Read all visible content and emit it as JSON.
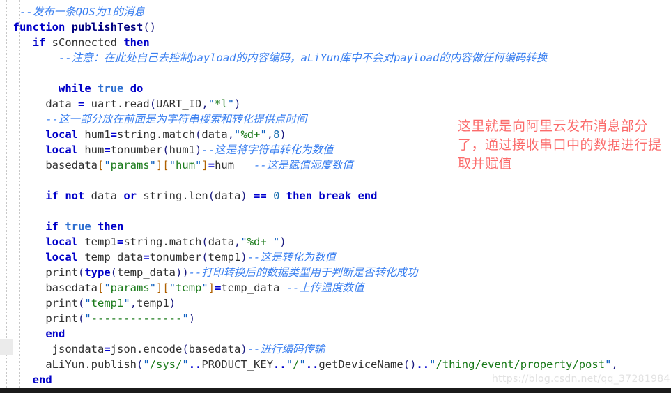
{
  "editor": {
    "language": "lua",
    "background_color": "#ffffff",
    "indent_guide_color": "#c8c8c8",
    "comment_color": "#3a7ff0",
    "keyword_color": "#0000c8",
    "string_color": "#1a7a1a",
    "annotation_color": "#fb6b6b",
    "watermark_color": "#e2e2e2",
    "bottom_bar_color": "#1b1b1b"
  },
  "code": {
    "lines": [
      {
        "id": "line-1",
        "segments": [
          {
            "t": "--发布一条QOS为1的消息",
            "c": "cmt"
          }
        ],
        "indent": 2
      },
      {
        "id": "line-2",
        "segments": [
          {
            "t": "function",
            "c": "kw"
          },
          {
            "t": " ",
            "c": "id"
          },
          {
            "t": "publishTest",
            "c": "fn"
          },
          {
            "t": "()",
            "c": "punc"
          }
        ],
        "indent": 1
      },
      {
        "id": "line-3",
        "segments": [
          {
            "t": "if",
            "c": "kw"
          },
          {
            "t": " sConnected ",
            "c": "id"
          },
          {
            "t": "then",
            "c": "kw"
          }
        ],
        "indent": 4
      },
      {
        "id": "line-4",
        "segments": [
          {
            "t": "--注意：在此处自己去控制payload的内容编码，aLiYun库中不会对payload的内容做任何编码转换",
            "c": "cmt"
          }
        ],
        "indent": 8
      },
      {
        "id": "line-5",
        "segments": [],
        "indent": 0
      },
      {
        "id": "line-6",
        "segments": [
          {
            "t": "while",
            "c": "kw"
          },
          {
            "t": " ",
            "c": "id"
          },
          {
            "t": "true",
            "c": "bool"
          },
          {
            "t": " ",
            "c": "id"
          },
          {
            "t": "do",
            "c": "kw"
          }
        ],
        "indent": 8
      },
      {
        "id": "line-7",
        "segments": [
          {
            "t": "data ",
            "c": "id"
          },
          {
            "t": "=",
            "c": "op"
          },
          {
            "t": " uart",
            "c": "id"
          },
          {
            "t": ".",
            "c": "dot"
          },
          {
            "t": "read",
            "c": "id"
          },
          {
            "t": "(",
            "c": "punc"
          },
          {
            "t": "UART_ID",
            "c": "id"
          },
          {
            "t": ",",
            "c": "punc"
          },
          {
            "t": "\"",
            "c": "quo"
          },
          {
            "t": "*l",
            "c": "str"
          },
          {
            "t": "\"",
            "c": "quo"
          },
          {
            "t": ")",
            "c": "punc"
          }
        ],
        "indent": 6
      },
      {
        "id": "line-8",
        "segments": [
          {
            "t": "--这一部分放在前面是为字符串搜索和转化提供点时间",
            "c": "cmt"
          }
        ],
        "indent": 6
      },
      {
        "id": "line-9",
        "segments": [
          {
            "t": "local",
            "c": "kw"
          },
          {
            "t": " hum1",
            "c": "id"
          },
          {
            "t": "=",
            "c": "op"
          },
          {
            "t": "string",
            "c": "id"
          },
          {
            "t": ".",
            "c": "dot"
          },
          {
            "t": "match",
            "c": "id"
          },
          {
            "t": "(",
            "c": "punc"
          },
          {
            "t": "data",
            "c": "id"
          },
          {
            "t": ",",
            "c": "punc"
          },
          {
            "t": "\"",
            "c": "quo"
          },
          {
            "t": "%d+",
            "c": "str"
          },
          {
            "t": "\"",
            "c": "quo"
          },
          {
            "t": ",",
            "c": "punc"
          },
          {
            "t": "8",
            "c": "num"
          },
          {
            "t": ")",
            "c": "punc"
          }
        ],
        "indent": 6
      },
      {
        "id": "line-10",
        "segments": [
          {
            "t": "local",
            "c": "kw"
          },
          {
            "t": " hum",
            "c": "id"
          },
          {
            "t": "=",
            "c": "op"
          },
          {
            "t": "tonumber",
            "c": "id"
          },
          {
            "t": "(",
            "c": "punc"
          },
          {
            "t": "hum1",
            "c": "id"
          },
          {
            "t": ")",
            "c": "punc"
          },
          {
            "t": "--这是将字符串转化为数值",
            "c": "cmt"
          }
        ],
        "indent": 6
      },
      {
        "id": "line-11",
        "segments": [
          {
            "t": "basedata",
            "c": "id"
          },
          {
            "t": "[",
            "c": "brk"
          },
          {
            "t": "\"",
            "c": "quo"
          },
          {
            "t": "params",
            "c": "str"
          },
          {
            "t": "\"",
            "c": "quo"
          },
          {
            "t": "]",
            "c": "brk"
          },
          {
            "t": "[",
            "c": "brk"
          },
          {
            "t": "\"",
            "c": "quo"
          },
          {
            "t": "hum",
            "c": "str"
          },
          {
            "t": "\"",
            "c": "quo"
          },
          {
            "t": "]",
            "c": "brk"
          },
          {
            "t": "=",
            "c": "op"
          },
          {
            "t": "hum",
            "c": "id"
          },
          {
            "t": "   ",
            "c": "id"
          },
          {
            "t": "--这是赋值湿度数值",
            "c": "cmt"
          }
        ],
        "indent": 6
      },
      {
        "id": "line-12",
        "segments": [],
        "indent": 0
      },
      {
        "id": "line-13",
        "segments": [
          {
            "t": "if",
            "c": "kw"
          },
          {
            "t": " ",
            "c": "id"
          },
          {
            "t": "not",
            "c": "kw"
          },
          {
            "t": " data ",
            "c": "id"
          },
          {
            "t": "or",
            "c": "kw"
          },
          {
            "t": " string",
            "c": "id"
          },
          {
            "t": ".",
            "c": "dot"
          },
          {
            "t": "len",
            "c": "id"
          },
          {
            "t": "(",
            "c": "punc"
          },
          {
            "t": "data",
            "c": "id"
          },
          {
            "t": ")",
            "c": "punc"
          },
          {
            "t": " ",
            "c": "id"
          },
          {
            "t": "==",
            "c": "op"
          },
          {
            "t": " ",
            "c": "id"
          },
          {
            "t": "0",
            "c": "num"
          },
          {
            "t": " ",
            "c": "id"
          },
          {
            "t": "then",
            "c": "kw"
          },
          {
            "t": " ",
            "c": "id"
          },
          {
            "t": "break",
            "c": "kw"
          },
          {
            "t": " ",
            "c": "id"
          },
          {
            "t": "end",
            "c": "kw"
          }
        ],
        "indent": 6
      },
      {
        "id": "line-14",
        "segments": [],
        "indent": 0
      },
      {
        "id": "line-15",
        "segments": [
          {
            "t": "if",
            "c": "kw"
          },
          {
            "t": " ",
            "c": "id"
          },
          {
            "t": "true",
            "c": "bool"
          },
          {
            "t": " ",
            "c": "id"
          },
          {
            "t": "then",
            "c": "kw"
          }
        ],
        "indent": 6
      },
      {
        "id": "line-16",
        "segments": [
          {
            "t": "local",
            "c": "kw"
          },
          {
            "t": " temp1",
            "c": "id"
          },
          {
            "t": "=",
            "c": "op"
          },
          {
            "t": "string",
            "c": "id"
          },
          {
            "t": ".",
            "c": "dot"
          },
          {
            "t": "match",
            "c": "id"
          },
          {
            "t": "(",
            "c": "punc"
          },
          {
            "t": "data",
            "c": "id"
          },
          {
            "t": ",",
            "c": "punc"
          },
          {
            "t": "\"",
            "c": "quo"
          },
          {
            "t": "%d+ ",
            "c": "str"
          },
          {
            "t": "\"",
            "c": "quo"
          },
          {
            "t": ")",
            "c": "punc"
          }
        ],
        "indent": 6
      },
      {
        "id": "line-17",
        "segments": [
          {
            "t": "local",
            "c": "kw"
          },
          {
            "t": " temp_data",
            "c": "id"
          },
          {
            "t": "=",
            "c": "op"
          },
          {
            "t": "tonumber",
            "c": "id"
          },
          {
            "t": "(",
            "c": "punc"
          },
          {
            "t": "temp1",
            "c": "id"
          },
          {
            "t": ")",
            "c": "punc"
          },
          {
            "t": "--这是转化为数值",
            "c": "cmt"
          }
        ],
        "indent": 6
      },
      {
        "id": "line-18",
        "segments": [
          {
            "t": "print",
            "c": "id"
          },
          {
            "t": "(",
            "c": "punc"
          },
          {
            "t": "type",
            "c": "kw"
          },
          {
            "t": "(",
            "c": "punc"
          },
          {
            "t": "temp_data",
            "c": "id"
          },
          {
            "t": "))",
            "c": "punc"
          },
          {
            "t": "--打印转换后的数据类型用于判断是否转化成功",
            "c": "cmt"
          }
        ],
        "indent": 6
      },
      {
        "id": "line-19",
        "segments": [
          {
            "t": "basedata",
            "c": "id"
          },
          {
            "t": "[",
            "c": "brk"
          },
          {
            "t": "\"",
            "c": "quo"
          },
          {
            "t": "params",
            "c": "str"
          },
          {
            "t": "\"",
            "c": "quo"
          },
          {
            "t": "]",
            "c": "brk"
          },
          {
            "t": "[",
            "c": "brk"
          },
          {
            "t": "\"",
            "c": "quo"
          },
          {
            "t": "temp",
            "c": "str"
          },
          {
            "t": "\"",
            "c": "quo"
          },
          {
            "t": "]",
            "c": "brk"
          },
          {
            "t": "=",
            "c": "op"
          },
          {
            "t": "temp_data ",
            "c": "id"
          },
          {
            "t": "--上传温度数值",
            "c": "cmt"
          }
        ],
        "indent": 6
      },
      {
        "id": "line-20",
        "segments": [
          {
            "t": "print",
            "c": "id"
          },
          {
            "t": "(",
            "c": "punc"
          },
          {
            "t": "\"",
            "c": "quo"
          },
          {
            "t": "temp1",
            "c": "str"
          },
          {
            "t": "\"",
            "c": "quo"
          },
          {
            "t": ",",
            "c": "punc"
          },
          {
            "t": "temp1",
            "c": "id"
          },
          {
            "t": ")",
            "c": "punc"
          }
        ],
        "indent": 6
      },
      {
        "id": "line-21",
        "segments": [
          {
            "t": "print",
            "c": "id"
          },
          {
            "t": "(",
            "c": "punc"
          },
          {
            "t": "\"",
            "c": "quo"
          },
          {
            "t": "--------------",
            "c": "str"
          },
          {
            "t": "\"",
            "c": "quo"
          },
          {
            "t": ")",
            "c": "punc"
          }
        ],
        "indent": 6
      },
      {
        "id": "line-22",
        "segments": [
          {
            "t": "end",
            "c": "kw"
          }
        ],
        "indent": 6
      },
      {
        "id": "line-23",
        "segments": [
          {
            "t": "jsondata",
            "c": "id"
          },
          {
            "t": "=",
            "c": "op"
          },
          {
            "t": "json",
            "c": "id"
          },
          {
            "t": ".",
            "c": "dot"
          },
          {
            "t": "encode",
            "c": "id"
          },
          {
            "t": "(",
            "c": "punc"
          },
          {
            "t": "basedata",
            "c": "id"
          },
          {
            "t": ")",
            "c": "punc"
          },
          {
            "t": "--进行编码传输",
            "c": "cmt"
          }
        ],
        "indent": 7
      },
      {
        "id": "line-24",
        "segments": [
          {
            "t": "aLiYun",
            "c": "id"
          },
          {
            "t": ".",
            "c": "dot"
          },
          {
            "t": "publish",
            "c": "id"
          },
          {
            "t": "(",
            "c": "punc"
          },
          {
            "t": "\"",
            "c": "quo"
          },
          {
            "t": "/sys/",
            "c": "str"
          },
          {
            "t": "\"",
            "c": "quo"
          },
          {
            "t": "..",
            "c": "op"
          },
          {
            "t": "PRODUCT_KEY",
            "c": "id"
          },
          {
            "t": "..",
            "c": "op"
          },
          {
            "t": "\"",
            "c": "quo"
          },
          {
            "t": "/",
            "c": "str"
          },
          {
            "t": "\"",
            "c": "quo"
          },
          {
            "t": "..",
            "c": "op"
          },
          {
            "t": "getDeviceName",
            "c": "id"
          },
          {
            "t": "()",
            "c": "punc"
          },
          {
            "t": "..",
            "c": "op"
          },
          {
            "t": "\"",
            "c": "quo"
          },
          {
            "t": "/thing/event/property/post",
            "c": "str"
          },
          {
            "t": "\"",
            "c": "quo"
          },
          {
            "t": ",",
            "c": "punc"
          }
        ],
        "indent": 6
      },
      {
        "id": "line-25",
        "segments": [
          {
            "t": "end",
            "c": "kw"
          }
        ],
        "indent": 4
      }
    ]
  },
  "annotation": {
    "text": "这里就是向阿里云发布消息部分了，通过接收串口中的数据进行提取并赋值"
  },
  "watermark": {
    "text": "https://blog.csdn.net/qq_37281984"
  }
}
